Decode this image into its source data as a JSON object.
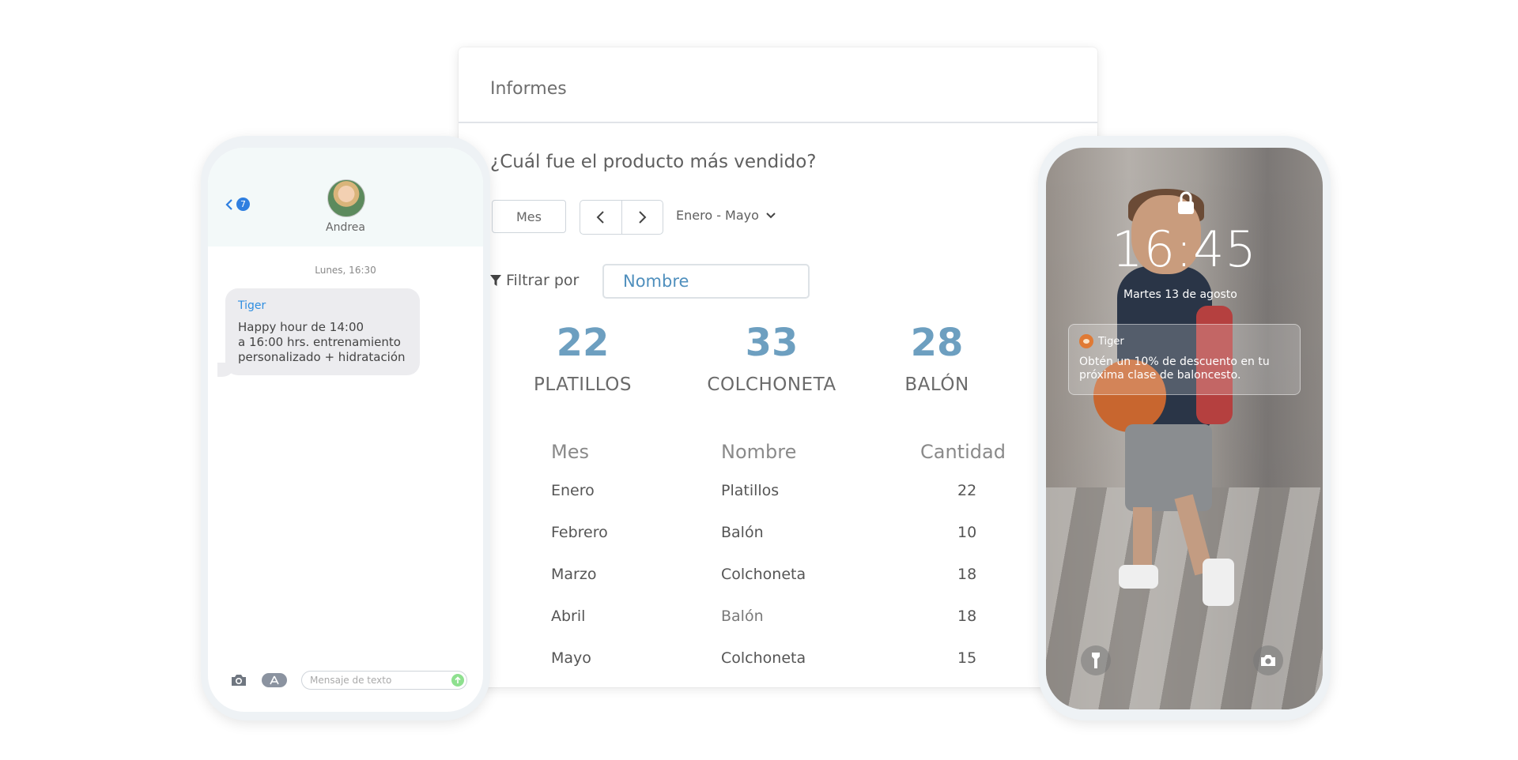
{
  "report": {
    "title": "Informes",
    "question": "¿Cuál fue el producto más vendido?",
    "period_button": "Mes",
    "range": "Enero - Mayo",
    "filter_label": "Filtrar por",
    "filter_placeholder": "Nombre",
    "stats": [
      {
        "value": "22",
        "label": "PLATILLOS"
      },
      {
        "value": "33",
        "label": "COLCHONETA"
      },
      {
        "value": "28",
        "label": "BALÓN"
      }
    ],
    "table": {
      "headers": [
        "Mes",
        "Nombre",
        "Cantidad"
      ],
      "rows": [
        [
          "Enero",
          "Platillos",
          "22"
        ],
        [
          "Febrero",
          "Balón",
          "10"
        ],
        [
          "Marzo",
          "Colchoneta",
          "18"
        ],
        [
          "Abril",
          "Balón",
          "18"
        ],
        [
          "Mayo",
          "Colchoneta",
          "15"
        ]
      ]
    },
    "accent_color": "#6d9fc0"
  },
  "messages": {
    "back_badge": "7",
    "contact_name": "Andrea",
    "date": "Lunes, 16:30",
    "bubble_sender": "Tiger",
    "bubble_text": "Happy hour de 14:00\na 16:00 hrs.  entrenamiento\npersonalizado + hidratación",
    "input_placeholder": "Mensaje de texto"
  },
  "lockscreen": {
    "time": "16:45",
    "date": "Martes 13 de agosto",
    "notification_app": "Tiger",
    "notification_text": "Obtén un 10% de descuento en tu próxima clase de baloncesto."
  },
  "icons": [
    "chevron-left-icon",
    "chevron-right-icon",
    "chevron-down-icon",
    "filter-icon",
    "camera-icon",
    "app-store-icon",
    "send-arrow-icon",
    "lock-icon",
    "flashlight-icon"
  ]
}
